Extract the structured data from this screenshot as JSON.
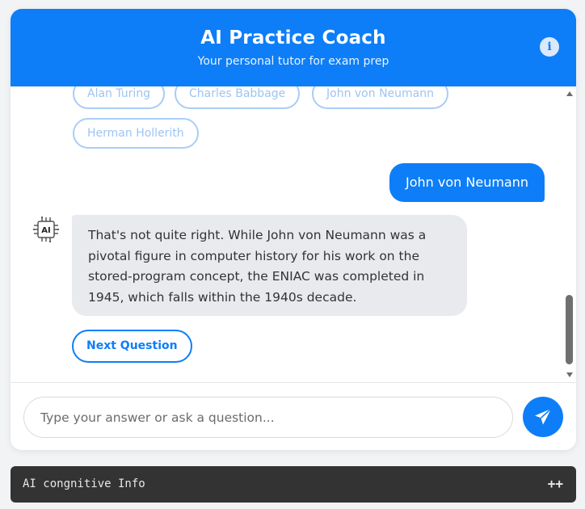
{
  "header": {
    "title": "AI Practice Coach",
    "subtitle": "Your personal tutor for exam prep",
    "info_icon": "i"
  },
  "options": [
    "Alan Turing",
    "Charles Babbage",
    "John von Neumann",
    "Herman Hollerith"
  ],
  "user_message": "John von Neumann",
  "ai_avatar_label": "AI",
  "ai_message": "That's not quite right. While John von Neumann was a pivotal figure in computer history for his work on the stored-program concept, the ENIAC was completed in 1945, which falls within the 1940s decade.",
  "next_button": "Next Question",
  "input": {
    "placeholder": "Type your answer or ask a question...",
    "value": ""
  },
  "info_bar": {
    "label": "AI congnitive Info",
    "toggle": "++"
  },
  "colors": {
    "primary": "#0d7ef8",
    "bubble_bg": "#e8eaed",
    "info_bar_bg": "#333333"
  }
}
